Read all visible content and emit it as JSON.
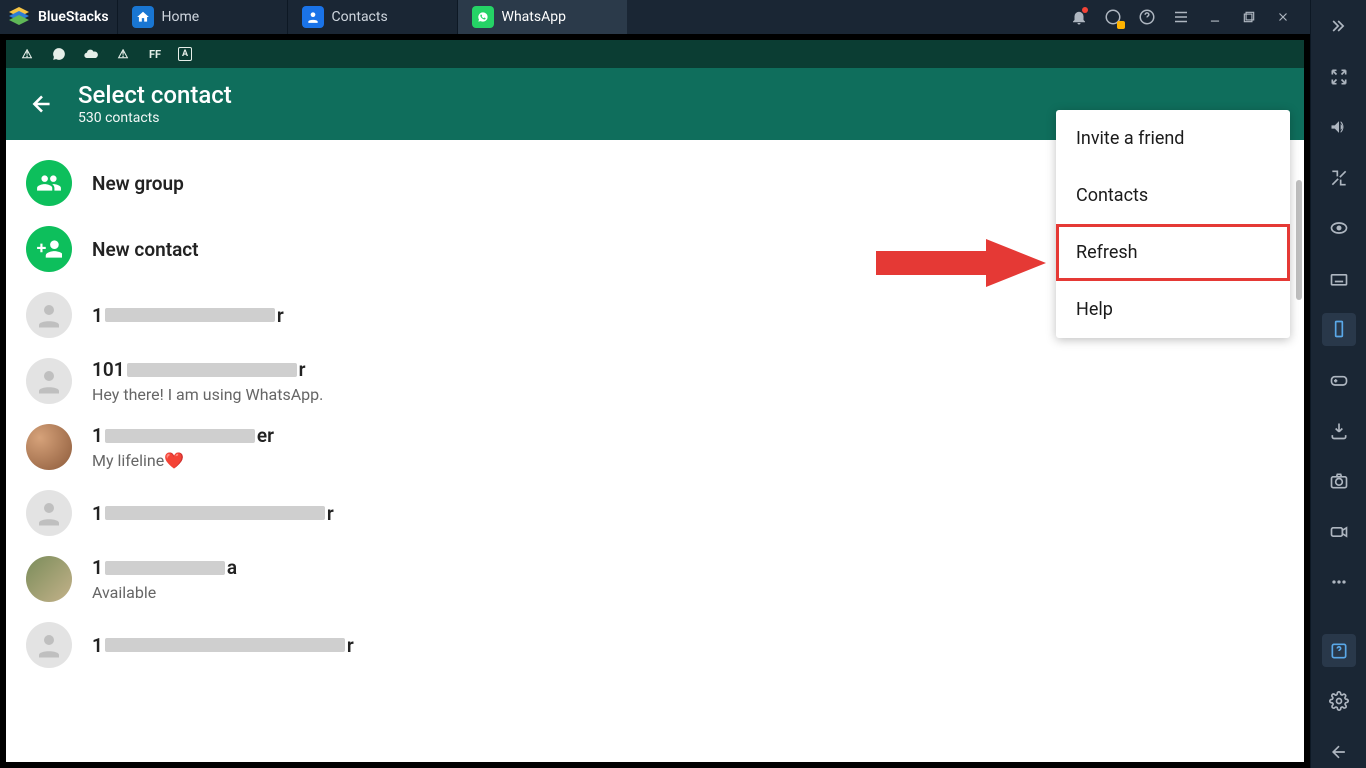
{
  "titlebar": {
    "brand": "BlueStacks",
    "tabs": [
      {
        "label": "Home",
        "icon": "home"
      },
      {
        "label": "Contacts",
        "icon": "contacts"
      },
      {
        "label": "WhatsApp",
        "icon": "whatsapp",
        "active": true
      }
    ]
  },
  "whatsapp": {
    "header_title": "Select contact",
    "header_subtitle": "530 contacts",
    "new_group": "New group",
    "new_contact": "New contact",
    "contacts": [
      {
        "name_prefix": "1",
        "name_suffix": "r",
        "redact_w": 170,
        "subtitle": "",
        "avatar": "placeholder"
      },
      {
        "name_prefix": "101",
        "name_suffix": "r",
        "redact_w": 170,
        "subtitle": "Hey there! I am using WhatsApp.",
        "avatar": "placeholder"
      },
      {
        "name_prefix": "1",
        "name_suffix": "er",
        "redact_w": 150,
        "subtitle": "My lifeline❤️",
        "avatar": "photo1"
      },
      {
        "name_prefix": "1",
        "name_suffix": "r",
        "redact_w": 220,
        "subtitle": "",
        "avatar": "placeholder"
      },
      {
        "name_prefix": "1",
        "name_suffix": "a",
        "redact_w": 120,
        "subtitle": "Available",
        "avatar": "photo2"
      },
      {
        "name_prefix": "1",
        "name_suffix": "r",
        "redact_w": 240,
        "subtitle": "",
        "avatar": "placeholder"
      }
    ]
  },
  "menu": {
    "items": [
      {
        "label": "Invite a friend"
      },
      {
        "label": "Contacts"
      },
      {
        "label": "Refresh",
        "highlight": true
      },
      {
        "label": "Help"
      }
    ]
  }
}
